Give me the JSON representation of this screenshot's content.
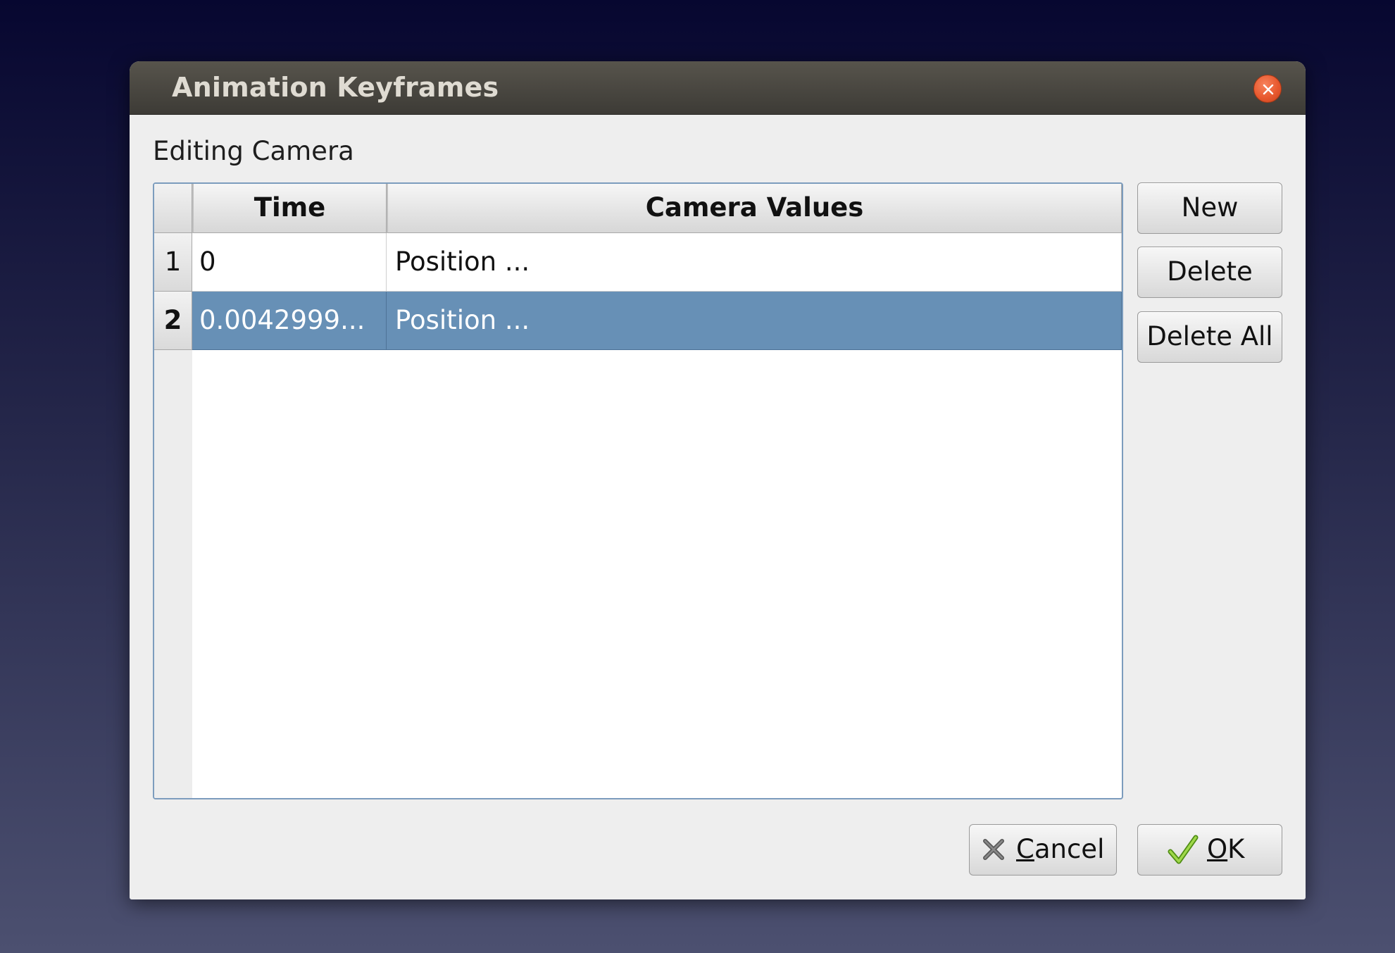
{
  "window": {
    "title": "Animation Keyframes"
  },
  "subtitle": "Editing Camera",
  "table": {
    "columns": [
      "Time",
      "Camera Values"
    ],
    "rows": [
      {
        "num": "1",
        "time": "0",
        "values": "Position ...",
        "selected": false
      },
      {
        "num": "2",
        "time": "0.0042999...",
        "values": "Position ...",
        "selected": true
      }
    ]
  },
  "side_buttons": {
    "new": "New",
    "delete": "Delete",
    "delete_all": "Delete All"
  },
  "footer": {
    "cancel_mnemonic": "C",
    "cancel_rest": "ancel",
    "ok_mnemonic": "O",
    "ok_rest": "K"
  },
  "colors": {
    "selection": "#6790b6",
    "close_button": "#e8592f",
    "titlebar": "#4a4842",
    "ok_check": "#7bbf2a"
  },
  "icons": {
    "close": "close-icon",
    "cancel": "x-icon",
    "ok": "checkmark-icon"
  }
}
